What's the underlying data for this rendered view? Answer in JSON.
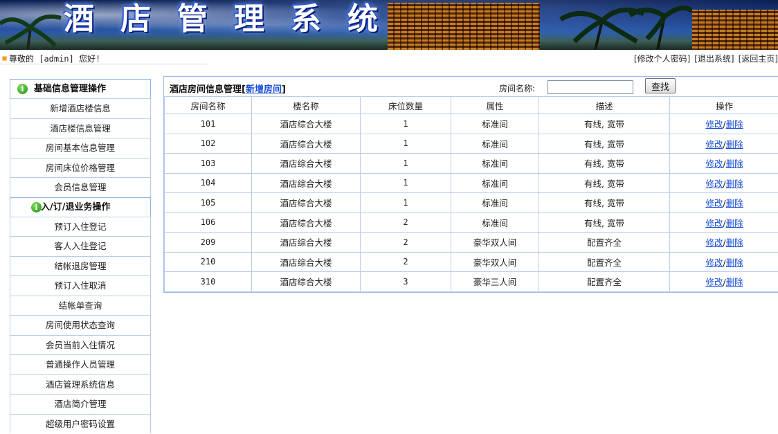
{
  "banner": {
    "title_chars": [
      "酒",
      "店",
      "管",
      "理",
      "系",
      "统"
    ]
  },
  "topbar": {
    "greeting": "尊敬的 [admin] 您好!",
    "links": [
      "[修改个人密码]",
      "[退出系统]",
      "[返回主页]"
    ]
  },
  "sidebar": {
    "section1": "基础信息管理操作",
    "group1": [
      "新增酒店楼信息",
      "酒店楼信息管理",
      "房间基本信息管理",
      "房间床位价格管理",
      "会员信息管理"
    ],
    "section2": "入/订/退业务操作",
    "group2": [
      "预订入住登记",
      "客人入住登记",
      "结帐退房管理",
      "预订入住取消",
      "结帐单查询",
      "房间使用状态查询",
      "会员当前入住情况",
      "普通操作人员管理",
      "酒店管理系统信息",
      "酒店简介管理",
      "超级用户密码设置"
    ]
  },
  "panel": {
    "title": "酒店房间信息管理",
    "add_link": "新增房间",
    "search_label": "房间名称:",
    "search_value": "",
    "search_button": "查找",
    "columns": [
      "房间名称",
      "楼名称",
      "床位数量",
      "属性",
      "描述",
      "操作"
    ],
    "edit_label": "修改",
    "delete_label": "删除",
    "rows": [
      {
        "name": "101",
        "building": "酒店综合大楼",
        "beds": "1",
        "type": "标准间",
        "desc": "有线, 宽带"
      },
      {
        "name": "102",
        "building": "酒店综合大楼",
        "beds": "1",
        "type": "标准间",
        "desc": "有线, 宽带"
      },
      {
        "name": "103",
        "building": "酒店综合大楼",
        "beds": "1",
        "type": "标准间",
        "desc": "有线, 宽带"
      },
      {
        "name": "104",
        "building": "酒店综合大楼",
        "beds": "1",
        "type": "标准间",
        "desc": "有线, 宽带"
      },
      {
        "name": "105",
        "building": "酒店综合大楼",
        "beds": "1",
        "type": "标准间",
        "desc": "有线, 宽带"
      },
      {
        "name": "106",
        "building": "酒店综合大楼",
        "beds": "2",
        "type": "标准间",
        "desc": "有线, 宽带"
      },
      {
        "name": "209",
        "building": "酒店综合大楼",
        "beds": "2",
        "type": "豪华双人间",
        "desc": "配置齐全"
      },
      {
        "name": "210",
        "building": "酒店综合大楼",
        "beds": "2",
        "type": "豪华双人间",
        "desc": "配置齐全"
      },
      {
        "name": "310",
        "building": "酒店综合大楼",
        "beds": "3",
        "type": "豪华三人间",
        "desc": "配置齐全"
      }
    ]
  },
  "colors": {
    "link": "#1a4fd6",
    "border": "#b8cde8",
    "info_icon": "#1f8a12",
    "bullet": "#f39a1c"
  }
}
